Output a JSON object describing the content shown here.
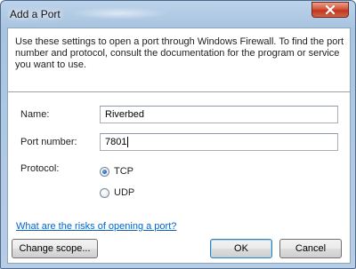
{
  "window": {
    "title": "Add a Port"
  },
  "intro_text": "Use these settings to open a port through Windows Firewall. To find the port number and protocol, consult the documentation for the program or service you want to use.",
  "fields": {
    "name_label": "Name:",
    "name_value": "Riverbed",
    "port_label": "Port number:",
    "port_value": "7801"
  },
  "protocol": {
    "label": "Protocol:",
    "options": [
      {
        "label": "TCP",
        "selected": true
      },
      {
        "label": "UDP",
        "selected": false
      }
    ]
  },
  "link_text": "What are the risks of opening a port?",
  "buttons": {
    "change_scope": "Change scope...",
    "ok": "OK",
    "cancel": "Cancel"
  },
  "colors": {
    "link": "#0066cc",
    "close_button": "#c2361c",
    "title_bar": "#a9c4e0"
  },
  "icons": {
    "close": "close-icon"
  }
}
